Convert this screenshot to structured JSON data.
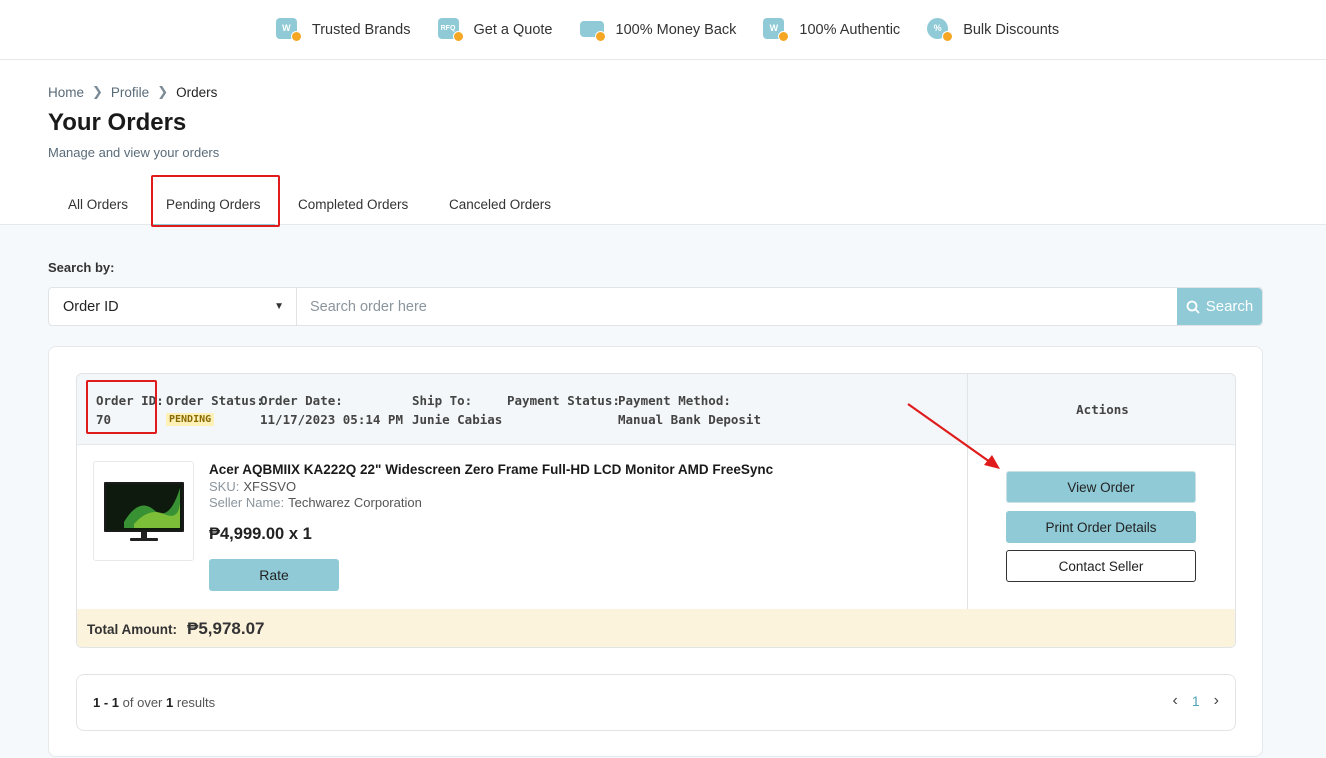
{
  "benefits": [
    {
      "label": "Trusted Brands",
      "icon": "w-badge-icon",
      "glyph": "W"
    },
    {
      "label": "Get a Quote",
      "icon": "rfq-icon",
      "glyph": "RFQ"
    },
    {
      "label": "100% Money Back",
      "icon": "money-back-icon",
      "glyph": ""
    },
    {
      "label": "100% Authentic",
      "icon": "authentic-star-icon",
      "glyph": "W"
    },
    {
      "label": "Bulk Discounts",
      "icon": "discount-icon",
      "glyph": "%"
    }
  ],
  "breadcrumb": {
    "home": "Home",
    "profile": "Profile",
    "current": "Orders"
  },
  "page": {
    "title": "Your Orders",
    "subtitle": "Manage and view your orders"
  },
  "tabs": [
    "All Orders",
    "Pending Orders",
    "Completed Orders",
    "Canceled Orders"
  ],
  "search": {
    "label": "Search by:",
    "selected": "Order ID",
    "placeholder": "Search order here",
    "button": "Search"
  },
  "order": {
    "id_label": "Order ID:",
    "id": "70",
    "status_label": "Order Status:",
    "status": "PENDING",
    "date_label": "Order Date:",
    "date": "11/17/2023 05:14 PM",
    "ship_label": "Ship To:",
    "ship_to": "Junie Cabias",
    "pay_status_label": "Payment Status:",
    "pay_method_label": "Payment Method:",
    "pay_method": "Manual Bank Deposit",
    "actions_label": "Actions",
    "product": {
      "name": "Acer AQBMIIX KA222Q 22\" Widescreen Zero Frame Full-HD LCD Monitor AMD FreeSync",
      "sku_label": "SKU:",
      "sku": "XFSSVO",
      "seller_label": "Seller Name:",
      "seller": "Techwarez Corporation",
      "price": "₱4,999.00 x 1",
      "rate": "Rate"
    },
    "buttons": {
      "view": "View Order",
      "print": "Print Order Details",
      "contact": "Contact Seller"
    },
    "total_label": "Total Amount:",
    "total": "₱5,978.07"
  },
  "pagination": {
    "range": "1 - 1",
    "of_over": "of over",
    "total": "1",
    "results": "results",
    "page": "1"
  },
  "colors": {
    "accent": "#8fcad6",
    "highlight": "#e01b1b",
    "total_bg": "#fcf3dc"
  }
}
